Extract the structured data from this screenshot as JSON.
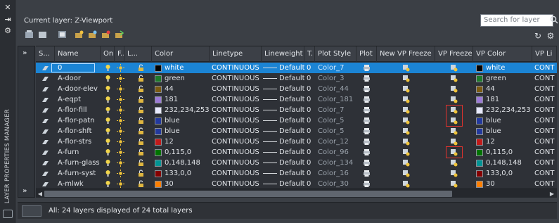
{
  "panel": {
    "vertical_title": "LAYER PROPERTIES MANAGER",
    "current_layer": "Current layer: Z-Viewport",
    "search_placeholder": "Search for layer",
    "status": "All: 24 layers displayed of 24 total layers"
  },
  "columns": [
    "S...",
    "Name",
    "On",
    "F...",
    "L...",
    "Color",
    "Linetype",
    "Lineweight",
    "T.",
    "Plot Style",
    "Plot",
    "New VP Freeze",
    "VP Freeze",
    "VP Color",
    "VP Li"
  ],
  "rows": [
    {
      "name": "0",
      "color": "white",
      "swatch": "#000000",
      "linetype": "CONTINUOUS",
      "lineweight": "Default",
      "t": "0",
      "plotstyle": "Color_7",
      "vpcolor": "white",
      "vpswatch": "#000000",
      "vpl": "CONT",
      "selected": true
    },
    {
      "name": "A-door",
      "color": "green",
      "swatch": "#1f7a2b",
      "linetype": "CONTINUOUS",
      "lineweight": "Default",
      "t": "0",
      "plotstyle": "Color_3",
      "vpcolor": "green",
      "vpswatch": "#1f7a2b",
      "vpl": "CONT"
    },
    {
      "name": "A-door-elev",
      "color": "44",
      "swatch": "#7a5a12",
      "linetype": "CONTINUOUS",
      "lineweight": "Default",
      "t": "0",
      "plotstyle": "Color_44",
      "vpcolor": "44",
      "vpswatch": "#7a5a12",
      "vpl": "CONT"
    },
    {
      "name": "A-eqpt",
      "color": "181",
      "swatch": "#9c7ad6",
      "linetype": "CONTINUOUS",
      "lineweight": "Default",
      "t": "0",
      "plotstyle": "Color_181",
      "vpcolor": "181",
      "vpswatch": "#9c7ad6",
      "vpl": "CONT"
    },
    {
      "name": "A-flor-fill",
      "color": "232,234,253",
      "swatch": "#e8eafd",
      "linetype": "CONTINUOUS",
      "lineweight": "Default",
      "t": "0",
      "plotstyle": "Color_7",
      "vpcolor": "232,234,253",
      "vpswatch": "#e8eafd",
      "vpl": "CONT"
    },
    {
      "name": "A-flor-patn",
      "color": "blue",
      "swatch": "#23399e",
      "linetype": "CONTINUOUS",
      "lineweight": "Default",
      "t": "0",
      "plotstyle": "Color_5",
      "vpcolor": "blue",
      "vpswatch": "#23399e",
      "vpl": "CONT"
    },
    {
      "name": "A-flor-shft",
      "color": "blue",
      "swatch": "#23399e",
      "linetype": "CONTINUOUS",
      "lineweight": "Default",
      "t": "0",
      "plotstyle": "Color_5",
      "vpcolor": "blue",
      "vpswatch": "#23399e",
      "vpl": "CONT"
    },
    {
      "name": "A-flor-strs",
      "color": "12",
      "swatch": "#c21a1a",
      "linetype": "CONTINUOUS",
      "lineweight": "Default",
      "t": "0",
      "plotstyle": "Color_12",
      "vpcolor": "12",
      "vpswatch": "#c21a1a",
      "vpl": "CONT"
    },
    {
      "name": "A-furn",
      "color": "0,115,0",
      "swatch": "#007300",
      "linetype": "CONTINUOUS",
      "lineweight": "Default",
      "t": "0",
      "plotstyle": "Color_96",
      "vpcolor": "0,115,0",
      "vpswatch": "#007300",
      "vpl": "CONT"
    },
    {
      "name": "A-furn-glass",
      "color": "0,148,148",
      "swatch": "#009494",
      "linetype": "CONTINUOUS",
      "lineweight": "Default",
      "t": "0",
      "plotstyle": "Color_134",
      "vpcolor": "0,148,148",
      "vpswatch": "#009494",
      "vpl": "CONT"
    },
    {
      "name": "A-furn-syst",
      "color": "133,0,0",
      "swatch": "#850000",
      "linetype": "CONTINUOUS",
      "lineweight": "Default",
      "t": "0",
      "plotstyle": "Color_16",
      "vpcolor": "133,0,0",
      "vpswatch": "#850000",
      "vpl": "CONT"
    },
    {
      "name": "A-mlwk",
      "color": "30",
      "swatch": "#ff7f00",
      "linetype": "CONTINUOUS",
      "lineweight": "Default",
      "t": "0",
      "plotstyle": "Color_30",
      "vpcolor": "30",
      "vpswatch": "#ff7f00",
      "vpl": "CONT"
    }
  ],
  "highlighted_vp_freeze_rows": [
    4,
    5,
    8
  ],
  "colors": {
    "selection": "#1b84d4",
    "highlight_box": "#e0322e",
    "background": "#3b3f45"
  }
}
